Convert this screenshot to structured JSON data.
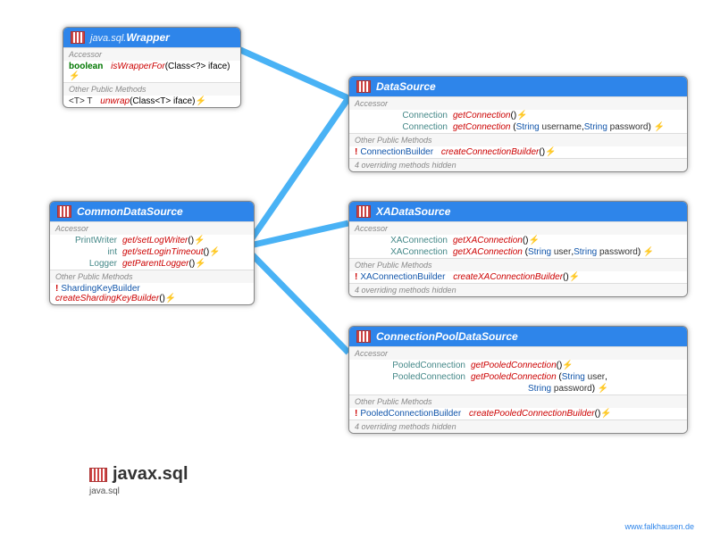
{
  "wrapper": {
    "title_pkg": "java.sql.",
    "title_name": "Wrapper",
    "sec1": "Accessor",
    "r1_ret": "boolean",
    "r1_method": "isWrapperFor",
    "r1_params": "(Class<?> iface)",
    "r1_tail": "⚡",
    "sec2": "Other Public Methods",
    "r2_ret": "<T> T",
    "r2_method": "unwrap",
    "r2_params": "(Class<T> iface)",
    "r2_tail": "⚡"
  },
  "cds": {
    "title": "CommonDataSource",
    "sec1": "Accessor",
    "r1_ret": "PrintWriter",
    "r1_method": "get/setLogWriter",
    "r1_params": "()",
    "r1_tail": "⚡",
    "r2_ret": "int",
    "r2_method": "get/setLoginTimeout",
    "r2_params": "()",
    "r2_tail": "⚡",
    "r3_ret": "Logger",
    "r3_method": "getParentLogger",
    "r3_params": "()",
    "r3_tail": "⚡",
    "sec2": "Other Public Methods",
    "r4_ret": "ShardingKeyBuilder",
    "r4_method": "createShardingKeyBuilder",
    "r4_params": "()",
    "r4_tail": "⚡"
  },
  "ds": {
    "title": "DataSource",
    "sec1": "Accessor",
    "r1_ret": "Connection",
    "r1_method": "getConnection",
    "r1_params": "()",
    "r1_tail": "⚡",
    "r2_ret": "Connection",
    "r2_method": "getConnection",
    "r2_p1t": "String",
    "r2_p1n": "username",
    "r2_p2t": "String",
    "r2_p2n": "password",
    "r2_tail": "⚡",
    "sec2": "Other Public Methods",
    "r3_ret": "ConnectionBuilder",
    "r3_method": "createConnectionBuilder",
    "r3_params": "()",
    "r3_tail": "⚡",
    "hidden": "4 overriding methods hidden"
  },
  "xa": {
    "title": "XADataSource",
    "sec1": "Accessor",
    "r1_ret": "XAConnection",
    "r1_method": "getXAConnection",
    "r1_params": "()",
    "r1_tail": "⚡",
    "r2_ret": "XAConnection",
    "r2_method": "getXAConnection",
    "r2_p1t": "String",
    "r2_p1n": "user",
    "r2_p2t": "String",
    "r2_p2n": "password",
    "r2_tail": "⚡",
    "sec2": "Other Public Methods",
    "r3_ret": "XAConnectionBuilder",
    "r3_method": "createXAConnectionBuilder",
    "r3_params": "()",
    "r3_tail": "⚡",
    "hidden": "4 overriding methods hidden"
  },
  "cpds": {
    "title": "ConnectionPoolDataSource",
    "sec1": "Accessor",
    "r1_ret": "PooledConnection",
    "r1_method": "getPooledConnection",
    "r1_params": "()",
    "r1_tail": "⚡",
    "r2_ret": "PooledConnection",
    "r2_method": "getPooledConnection",
    "r2_p1t": "String",
    "r2_p1n": "user",
    "r2_line2_t": "String",
    "r2_line2_n": "password",
    "r2_tail": "⚡",
    "sec2": "Other Public Methods",
    "r3_ret": "PooledConnectionBuilder",
    "r3_method": "createPooledConnectionBuilder",
    "r3_params": "()",
    "r3_tail": "⚡",
    "hidden": "4 overriding methods hidden"
  },
  "footer": {
    "pkg": "javax.sql",
    "sub": "java.sql",
    "link": "www.falkhausen.de"
  }
}
